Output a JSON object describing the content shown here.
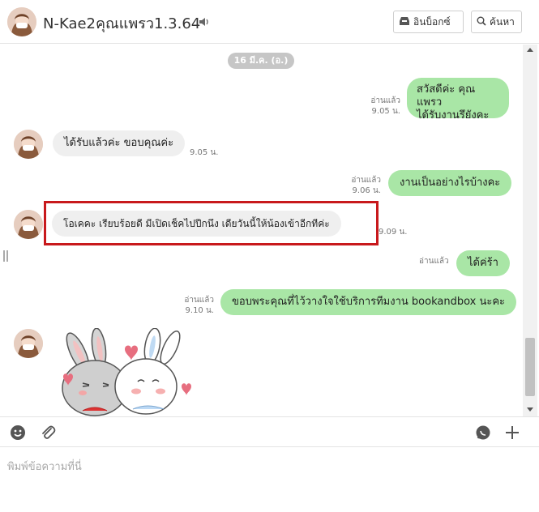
{
  "header": {
    "title": "N-Kae2คุณแพรว1.3.64",
    "inbox_label": "อินบ็อกซ์",
    "search_label": "ค้นหา"
  },
  "chat": {
    "date_label": "16 มี.ค. (อ.)",
    "messages": [
      {
        "side": "out",
        "text_line1": "สวัสดีค่ะ คุณแพรว",
        "text_line2": "ได้รับงานรึยังคะ",
        "read": "อ่านแล้ว",
        "time": "9.05 น."
      },
      {
        "side": "in",
        "text": "ได้รับแล้วค่ะ ขอบคุณค่ะ",
        "time": "9.05 น."
      },
      {
        "side": "out",
        "text": "งานเป็นอย่างไรบ้างคะ",
        "read": "อ่านแล้ว",
        "time": "9.06 น."
      },
      {
        "side": "in",
        "text": "โอเคคะ เรียบร้อยดี มีเปิดเช็คไปปีกนึง เดียวันนี้ให้น้องเข้าอีกทีค่ะ",
        "time": "9.09 น."
      },
      {
        "side": "out",
        "text": "ได้ค่ร้า",
        "read": "อ่านแล้ว",
        "time": ""
      },
      {
        "side": "out",
        "text": "ขอบพระคุณที่ไว้วางใจใช้บริการทีมงาน bookandbox นะคะ",
        "read": "อ่านแล้ว",
        "time": "9.10 น."
      }
    ]
  },
  "composer": {
    "placeholder": "พิมพ์ข้อความที่นี่"
  },
  "icons": {
    "speaker": "speaker-icon",
    "inbox": "inbox-icon",
    "search": "search-icon",
    "emoji": "emoji-icon",
    "attach": "paperclip-icon",
    "chat": "chat-bubble-icon",
    "add": "plus-icon"
  },
  "colors": {
    "outgoing_bubble": "#a9e6a6",
    "incoming_bubble": "#efefef",
    "highlight": "#c8191c",
    "date_pill": "#c6c6c6"
  }
}
